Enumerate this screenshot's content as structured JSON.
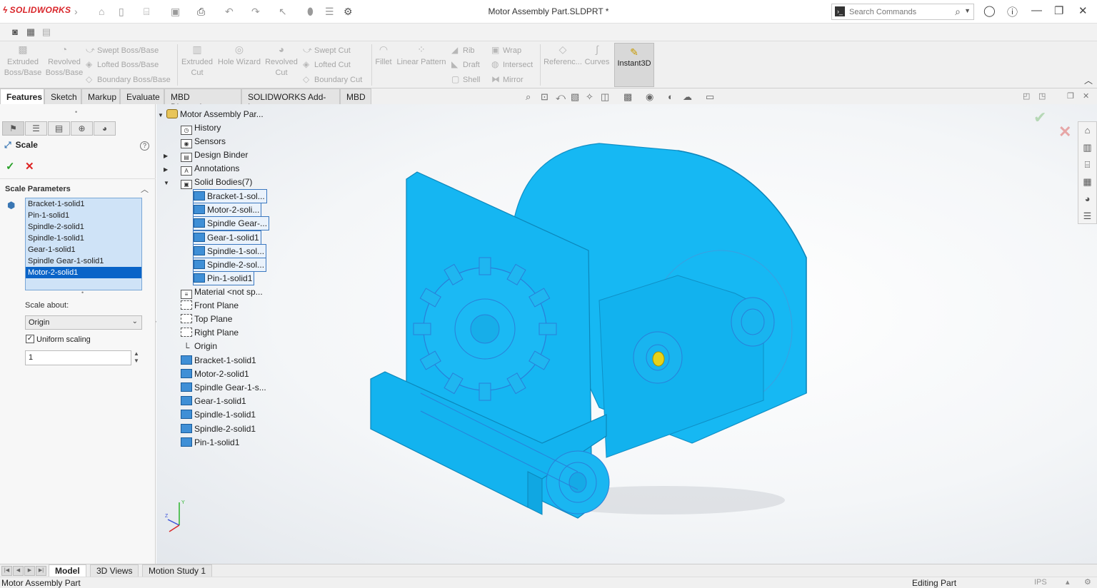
{
  "app": {
    "brand": "SOLIDWORKS",
    "window_title": "Motor Assembly Part.SLDPRT *",
    "search_placeholder": "Search Commands"
  },
  "command_manager": {
    "big_buttons": [
      {
        "label1": "Extruded",
        "label2": "Boss/Base"
      },
      {
        "label1": "Revolved",
        "label2": "Boss/Base"
      },
      {
        "label1": "Extruded",
        "label2": "Cut"
      },
      {
        "label1": "Hole Wizard",
        "label2": ""
      },
      {
        "label1": "Revolved",
        "label2": "Cut"
      },
      {
        "label1": "Fillet",
        "label2": ""
      },
      {
        "label1": "Linear Pattern",
        "label2": ""
      },
      {
        "label1": "Referenc...",
        "label2": ""
      },
      {
        "label1": "Curves",
        "label2": ""
      }
    ],
    "small_buttons": [
      "Swept Boss/Base",
      "Lofted Boss/Base",
      "Boundary Boss/Base",
      "Swept Cut",
      "Lofted Cut",
      "Boundary Cut",
      "Rib",
      "Draft",
      "Shell",
      "Wrap",
      "Intersect",
      "Mirror"
    ],
    "instant3d": "Instant3D"
  },
  "tabs": [
    "Features",
    "Sketch",
    "Markup",
    "Evaluate",
    "MBD Dimensions",
    "SOLIDWORKS Add-Ins",
    "MBD"
  ],
  "property_manager": {
    "title": "Scale",
    "section": "Scale Parameters",
    "bodies": [
      "Bracket-1-solid1",
      "Pin-1-solid1",
      "Spindle-2-solid1",
      "Spindle-1-solid1",
      "Gear-1-solid1",
      "Spindle Gear-1-solid1",
      "Motor-2-solid1"
    ],
    "selected_body": "Motor-2-solid1",
    "scale_about_label": "Scale about:",
    "scale_about_value": "Origin",
    "uniform_label": "Uniform scaling",
    "uniform_checked": true,
    "scale_value": "1"
  },
  "tree": {
    "root": "Motor Assembly Par...",
    "items": [
      "History",
      "Sensors",
      "Design Binder",
      "Annotations",
      "Solid Bodies(7)"
    ],
    "solid_bodies": [
      "Bracket-1-sol...",
      "Motor-2-soli...",
      "Spindle Gear-...",
      "Gear-1-solid1",
      "Spindle-1-sol...",
      "Spindle-2-sol...",
      "Pin-1-solid1"
    ],
    "rest": [
      "Material <not sp...",
      "Front Plane",
      "Top Plane",
      "Right Plane",
      "Origin",
      "Bracket-1-solid1",
      "Motor-2-solid1",
      "Spindle Gear-1-s...",
      "Gear-1-solid1",
      "Spindle-1-solid1",
      "Spindle-2-solid1",
      "Pin-1-solid1"
    ]
  },
  "bottom_tabs": [
    "Model",
    "3D Views",
    "Motion Study 1"
  ],
  "status": {
    "left": "Motor Assembly Part",
    "mode": "Editing Part",
    "units": "IPS"
  },
  "colors": {
    "model": "#16b8f3",
    "selection": "#0a64c8",
    "brand": "#d9262b"
  }
}
